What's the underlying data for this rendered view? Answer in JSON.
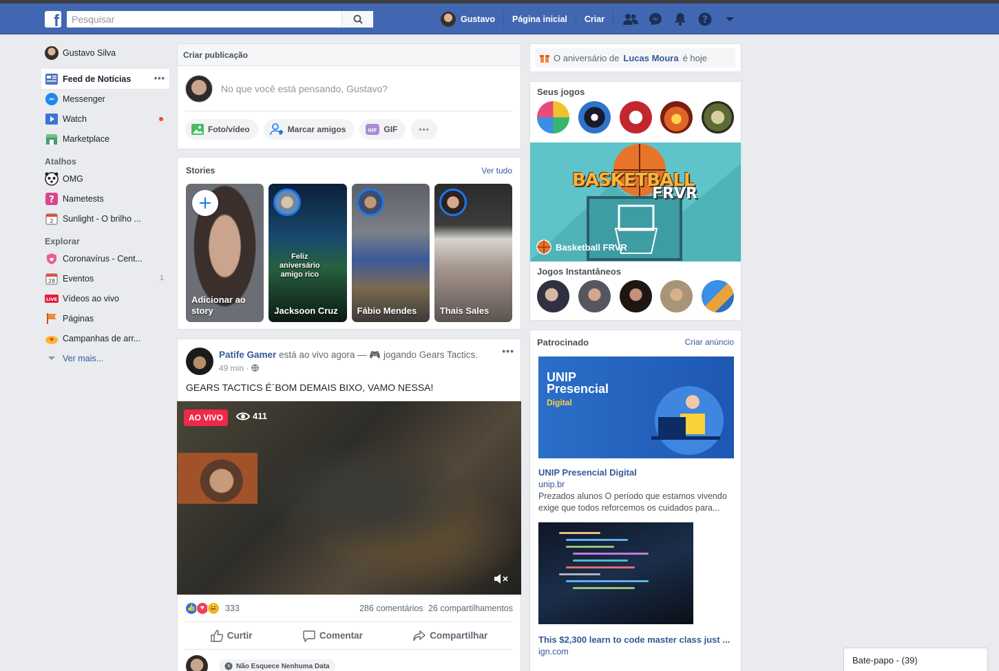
{
  "topbar": {
    "logo": "f",
    "search_placeholder": "Pesquisar",
    "user": "Gustavo",
    "home": "Página inicial",
    "create": "Criar"
  },
  "sidebar": {
    "user": "Gustavo Silva",
    "items": [
      {
        "label": "Feed de Notícias",
        "icon": "news-feed-icon",
        "active": true,
        "more": "•••"
      },
      {
        "label": "Messenger",
        "icon": "messenger-icon"
      },
      {
        "label": "Watch",
        "icon": "watch-icon",
        "dot": true
      },
      {
        "label": "Marketplace",
        "icon": "marketplace-icon"
      }
    ],
    "shortcuts_header": "Atalhos",
    "shortcuts": [
      {
        "label": "OMG",
        "icon": "panda-icon"
      },
      {
        "label": "Nametests",
        "icon": "nametests-icon"
      },
      {
        "label": "Sunlight - O brilho ...",
        "icon": "calendar-2-icon"
      }
    ],
    "explore_header": "Explorar",
    "explore": [
      {
        "label": "Coronavírus - Cent...",
        "icon": "coronavirus-icon"
      },
      {
        "label": "Eventos",
        "icon": "events-icon",
        "count": "1"
      },
      {
        "label": "Vídeos ao vivo",
        "icon": "live-icon"
      },
      {
        "label": "Páginas",
        "icon": "pages-flag-icon"
      },
      {
        "label": "Campanhas de arr...",
        "icon": "fundraiser-icon"
      }
    ],
    "see_more": "Ver mais..."
  },
  "composer": {
    "title": "Criar publicação",
    "placeholder": "No que você está pensando, Gustavo?",
    "actions": [
      "Foto/vídeo",
      "Marcar amigos",
      "GIF"
    ],
    "more": "•••"
  },
  "stories": {
    "title": "Stories",
    "see_all": "Ver tudo",
    "items": [
      {
        "name": "Adicionar ao story"
      },
      {
        "name": "Jacksoon Cruz",
        "caption": "Feliz aniversário amigo rico"
      },
      {
        "name": "Fábio Mendes"
      },
      {
        "name": "Thaís Sales"
      }
    ]
  },
  "post": {
    "author": "Patife Gamer",
    "status": "está ao vivo agora — 🎮 jogando Gears Tactics.",
    "time": "49 min",
    "text": "GEARS TACTICS É´BOM DEMAIS BIXO, VAMO NESSA!",
    "live_label": "AO VIVO",
    "viewers": "411",
    "reactions_count": "333",
    "comments": "286 comentários",
    "shares": "26 compartilhamentos",
    "actions": [
      "Curtir",
      "Comentar",
      "Compartilhar"
    ],
    "comment_chip": "Não Esquece Nenhuma Data",
    "menu": "•••"
  },
  "birthday": {
    "prefix": "O aniversário de",
    "name": "Lucas Moura",
    "suffix": "é hoje"
  },
  "games": {
    "title": "Seus jogos",
    "banner_title": "BASKETBALL",
    "banner_sub": "FRVR",
    "banner_name": "Basketball FRVR",
    "instant_title": "Jogos Instantâneos"
  },
  "sponsored": {
    "title": "Patrocinado",
    "create_ad": "Criar anúncio",
    "ad1": {
      "img_title": "UNIP Presencial",
      "img_sub": "Digital",
      "title": "UNIP Presencial Digital",
      "url": "unip.br",
      "desc": "Prezados alunos O período que estamos vivendo exige que todos reforcemos os cuidados para..."
    },
    "ad2": {
      "title": "This $2,300 learn to code master class just ...",
      "url": "ign.com"
    }
  },
  "chat": {
    "label": "Bate-papo - (39)"
  },
  "colors": {
    "brand": "#4267b2",
    "link": "#365899",
    "live": "#f02849"
  }
}
